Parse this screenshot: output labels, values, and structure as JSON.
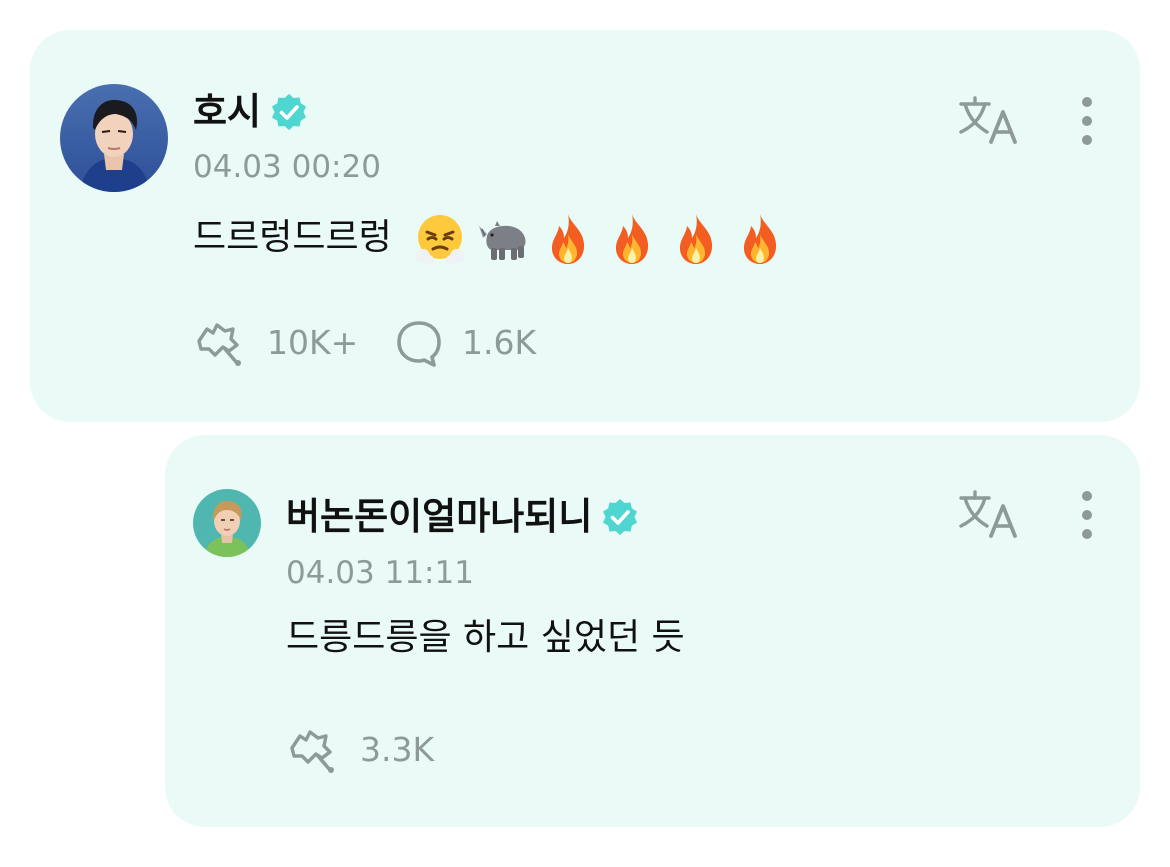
{
  "post": {
    "author": "호시",
    "verified": true,
    "timestamp": "04.03 00:20",
    "text": "드르렁드르렁",
    "emojis": [
      "face-with-steam-from-nose",
      "rhino",
      "fire",
      "fire",
      "fire",
      "fire"
    ],
    "cheer_count": "10K+",
    "comment_count": "1.6K",
    "avatar_icon": "avatar-photo"
  },
  "reply": {
    "author": "버논돈이얼마나되니",
    "verified": true,
    "timestamp": "04.03 11:11",
    "text": "드릉드릉을 하고 싶었던 듯",
    "cheer_count": "3.3K",
    "avatar_icon": "avatar-photo"
  },
  "icons": {
    "translate": "translate-icon",
    "more": "more-vertical-icon",
    "cheer": "cheer-icon",
    "comment": "comment-bubble-icon",
    "verified": "verified-badge-icon"
  },
  "colors": {
    "card_background": "#e9faf7",
    "verified_badge": "#4fd6d0",
    "muted_text": "#8d9a98",
    "primary_text": "#111111"
  }
}
